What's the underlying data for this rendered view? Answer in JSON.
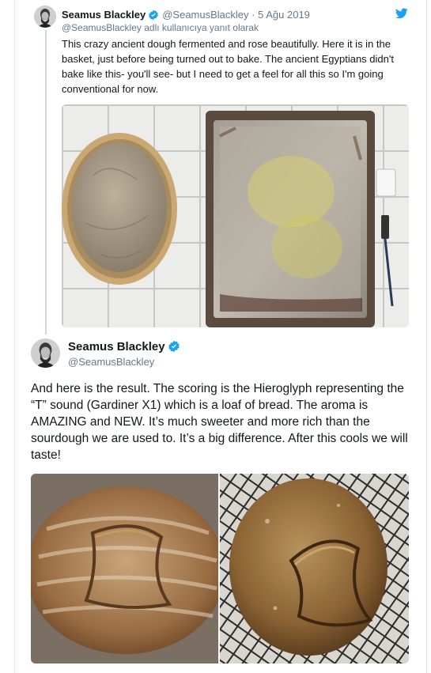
{
  "tweet1": {
    "name": "Seamus Blackley",
    "handle": "@SeamusBlackley",
    "separator": "·",
    "date": "5 Ağu 2019",
    "reply_to": "@SeamusBlackley adlı kullanıcıya yanıt olarak",
    "text": "This crazy ancient dough fermented and rose beautifully. Here it is in the basket, just before being turned out to bake. The ancient Egyptians didn't bake like this- you'll see- but I need to get a feel for all this so I'm going conventional for now."
  },
  "tweet2": {
    "name": "Seamus Blackley",
    "handle": "@SeamusBlackley",
    "text": "And here is the result. The scoring is the Hieroglyph representing the “T” sound (Gardiner X1) which is a loaf of bread. The aroma is AMAZING and NEW. It’s much sweeter and more rich than the sourdough we are used to. It’s a big difference. After this cools we will taste!"
  },
  "colors": {
    "twitter_blue": "#1da1f2",
    "verified_blue": "#1da1f2",
    "secondary_text": "#657786",
    "thread_line": "#ccd6dd"
  },
  "icons": {
    "brand": "twitter-bird-icon",
    "verified": "verified-badge-icon"
  }
}
